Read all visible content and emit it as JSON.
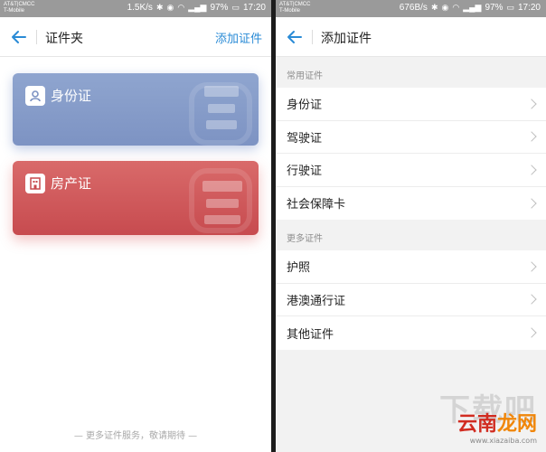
{
  "status_left": {
    "carrier": "AT&T|CMCC",
    "carrier2": "T-Mobile",
    "speed": "1.5K/s",
    "battery": "97%",
    "time": "17:20"
  },
  "status_right": {
    "carrier": "AT&T|CMCC",
    "carrier2": "T-Mobile",
    "speed": "676B/s",
    "battery": "97%",
    "time": "17:20"
  },
  "left_page": {
    "title": "证件夹",
    "action": "添加证件",
    "cards": [
      {
        "label": "身份证",
        "color": "#7d93c3",
        "icon": "person-icon"
      },
      {
        "label": "房产证",
        "color": "#c74b4f",
        "icon": "building-icon"
      }
    ],
    "footer": "— 更多证件服务，敬请期待 —"
  },
  "right_page": {
    "title": "添加证件",
    "sections": [
      {
        "header": "常用证件",
        "items": [
          "身份证",
          "驾驶证",
          "行驶证",
          "社会保障卡"
        ]
      },
      {
        "header": "更多证件",
        "items": [
          "护照",
          "港澳通行证",
          "其他证件"
        ]
      }
    ]
  },
  "watermark": {
    "big": "下载吧",
    "site_a": "云南",
    "site_b": "龙网",
    "url": "www.xiazaiba.com"
  },
  "colors": {
    "accent": "#2a8bd6",
    "statusbar": "#9a9a9a"
  }
}
